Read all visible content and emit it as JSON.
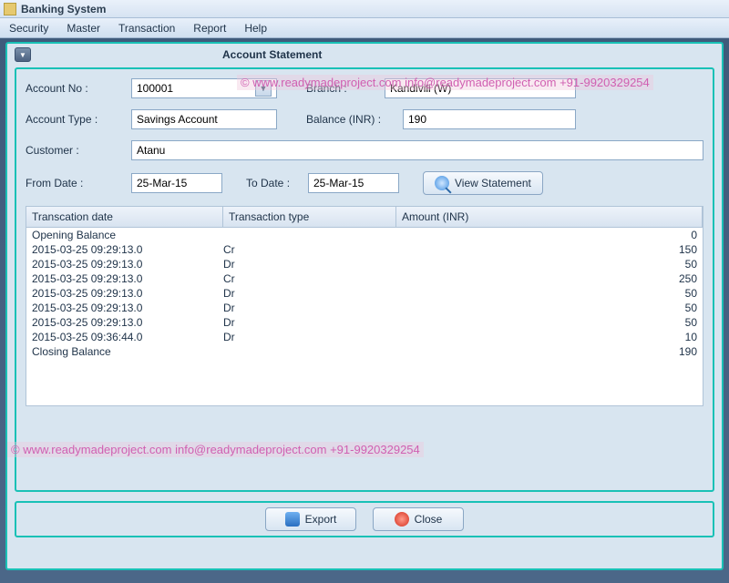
{
  "window": {
    "title": "Banking System"
  },
  "menu": {
    "items": [
      "Security",
      "Master",
      "Transaction",
      "Report",
      "Help"
    ]
  },
  "panel": {
    "title": "Account Statement"
  },
  "labels": {
    "account_no": "Account No :",
    "branch": "Branch :",
    "account_type": "Account Type :",
    "balance": "Balance (INR) :",
    "customer": "Customer :",
    "from_date": "From Date :",
    "to_date": "To Date :"
  },
  "values": {
    "account_no": "100001",
    "branch": "Kandivili (W)",
    "account_type": "Savings Account",
    "balance": "190",
    "customer": "Atanu",
    "from_date": "25-Mar-15",
    "to_date": "25-Mar-15"
  },
  "buttons": {
    "view": "View Statement",
    "export": "Export",
    "close": "Close"
  },
  "table": {
    "headers": {
      "date": "Transcation date",
      "type": "Transaction type",
      "amount": "Amount (INR)"
    },
    "rows": [
      {
        "date": "Opening Balance",
        "type": "",
        "amount": "0"
      },
      {
        "date": "2015-03-25 09:29:13.0",
        "type": "Cr",
        "amount": "150"
      },
      {
        "date": "2015-03-25 09:29:13.0",
        "type": "Dr",
        "amount": "50"
      },
      {
        "date": "2015-03-25 09:29:13.0",
        "type": "Cr",
        "amount": "250"
      },
      {
        "date": "2015-03-25 09:29:13.0",
        "type": "Dr",
        "amount": "50"
      },
      {
        "date": "2015-03-25 09:29:13.0",
        "type": "Dr",
        "amount": "50"
      },
      {
        "date": "2015-03-25 09:29:13.0",
        "type": "Dr",
        "amount": "50"
      },
      {
        "date": "2015-03-25 09:36:44.0",
        "type": "Dr",
        "amount": "10"
      },
      {
        "date": "Closing Balance",
        "type": "",
        "amount": "190"
      }
    ]
  },
  "watermark": {
    "top": "©  www.readymadeproject.com  info@readymadeproject.com  +91-9920329254",
    "bottom": "©  www.readymadeproject.com  info@readymadeproject.com  +91-9920329254"
  }
}
